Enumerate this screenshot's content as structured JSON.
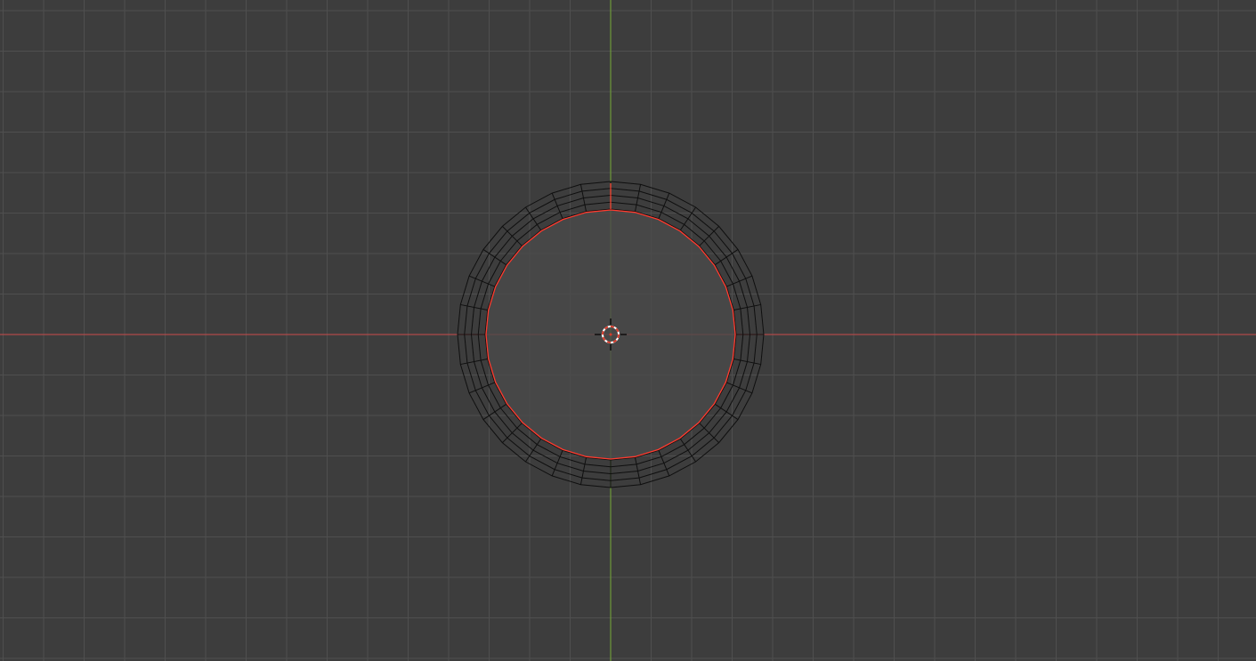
{
  "viewport": {
    "mode": "top-orthographic",
    "background_color": "#3d3d3d",
    "grid_color": "#4f4f4f",
    "grid": true
  },
  "axes": {
    "x_axis_color": "#b04a4a",
    "y_axis_color": "#6f9a3a"
  },
  "mesh": {
    "shape": "ring",
    "segments": 32,
    "rings": 4,
    "wire_color": "#0f0f0f",
    "face_color": "#4a4a4a",
    "selected_edge_color": "#ff3b2f",
    "selection": "inner-edge-loop"
  },
  "cursor_3d": {
    "icon": "3d-cursor-icon",
    "ring_color": "#d83a2a",
    "ring_alt_color": "#ffffff"
  }
}
